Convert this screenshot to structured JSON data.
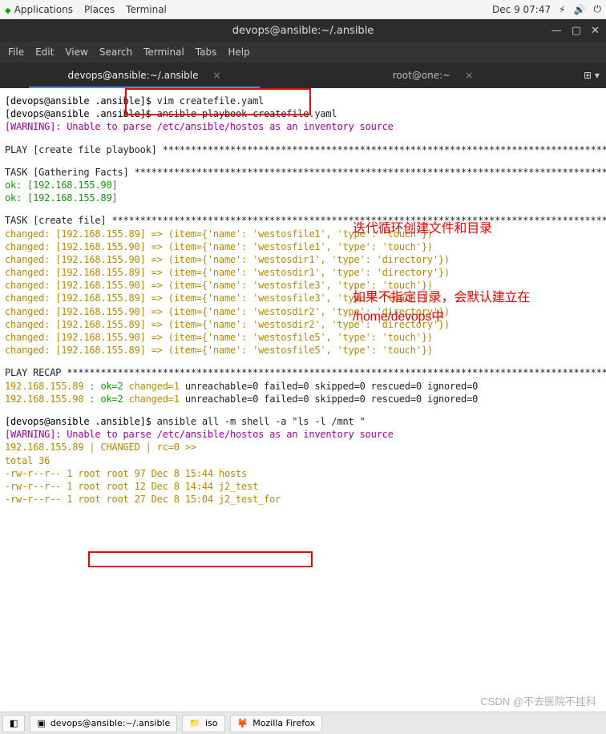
{
  "panel": {
    "apps": "Applications",
    "places": "Places",
    "terminal": "Terminal",
    "clock": "Dec 9 07:47"
  },
  "window": {
    "title": "devops@ansible:~/.ansible"
  },
  "menu": {
    "file": "File",
    "edit": "Edit",
    "view": "View",
    "search": "Search",
    "terminal": "Terminal",
    "tabs": "Tabs",
    "help": "Help"
  },
  "tabs": {
    "t1": "devops@ansible:~/.ansible",
    "t2": "root@one:~"
  },
  "annotations": {
    "a1": "迭代循环创建文件和目录",
    "a2_l1": "如果不指定目录，会默认建立在",
    "a2_l2": "/home/devops中"
  },
  "term": {
    "p1_prompt": "[devops@ansible .ansible]$ ",
    "p1_cmd": "vim createfile.yaml",
    "p2_prompt": "[devops@ansible .ansible]$ ",
    "p2_cmd": "ansible-playbook createfile.yaml",
    "warn1": "[WARNING]: Unable to parse /etc/ansible/hostos as an inventory source",
    "play_hdr": "PLAY [create file playbook] ",
    "task_gf": "TASK [Gathering Facts] ",
    "ok90": "ok: [192.168.155.90]",
    "ok89": "ok: [192.168.155.89]",
    "task_cf": "TASK [create file] ",
    "c1": "changed: [192.168.155.89] => (item={'name': 'westosfile1', 'type': 'touch'})",
    "c2": "changed: [192.168.155.90] => (item={'name': 'westosfile1', 'type': 'touch'})",
    "c3": "changed: [192.168.155.90] => (item={'name': 'westosdir1', 'type': 'directory'})",
    "c4": "changed: [192.168.155.89] => (item={'name': 'westosdir1', 'type': 'directory'})",
    "c5": "changed: [192.168.155.90] => (item={'name': 'westosfile3', 'type': 'touch'})",
    "c6": "changed: [192.168.155.89] => (item={'name': 'westosfile3', 'type': 'touch'})",
    "c7": "changed: [192.168.155.90] => (item={'name': 'westosdir2', 'type': 'directory'})",
    "c8": "changed: [192.168.155.89] => (item={'name': 'westosdir2', 'type': 'directory'})",
    "c9": "changed: [192.168.155.90] => (item={'name': 'westosfile5', 'type': 'touch'})",
    "c10": "changed: [192.168.155.89] => (item={'name': 'westosfile5', 'type': 'touch'})",
    "recap_hdr": "PLAY RECAP ",
    "recap89_h": "192.168.155.89",
    "recap89_okn": ": ok=2",
    "recap89_ch": "changed=1",
    "recap89_rest": "    unreachable=0    failed=0    skipped=0    rescued=0    ignored=0",
    "recap90_h": "192.168.155.90",
    "recap90_okn": ": ok=2",
    "recap90_ch": "changed=1",
    "recap90_rest": "    unreachable=0    failed=0    skipped=0    rescued=0    ignored=0",
    "p3_prompt": "[devops@ansible .ansible]$ ",
    "p3_cmd": "ansible all -m shell -a \"ls -l /mnt \"",
    "warn2": "[WARNING]: Unable to parse /etc/ansible/hostos as an inventory source",
    "chg_hdr": "192.168.155.89 | CHANGED | rc=0 >>",
    "ls_total": "total 36",
    "ls1": "-rw-r--r-- 1 root root  97 Dec  8 15:44 hosts",
    "ls2": "-rw-r--r-- 1 root root  12 Dec  8 14:44 j2_test",
    "ls3": "-rw-r--r-- 1 root root  27 Dec  8 15:04 j2_test_for"
  },
  "taskbar": {
    "t1": "devops@ansible:~/.ansible",
    "t2": "iso",
    "t3": "Mozilla Firefox"
  },
  "watermark": "CSDN @不去医院不挂科",
  "stars": "****************************************************************************************************"
}
